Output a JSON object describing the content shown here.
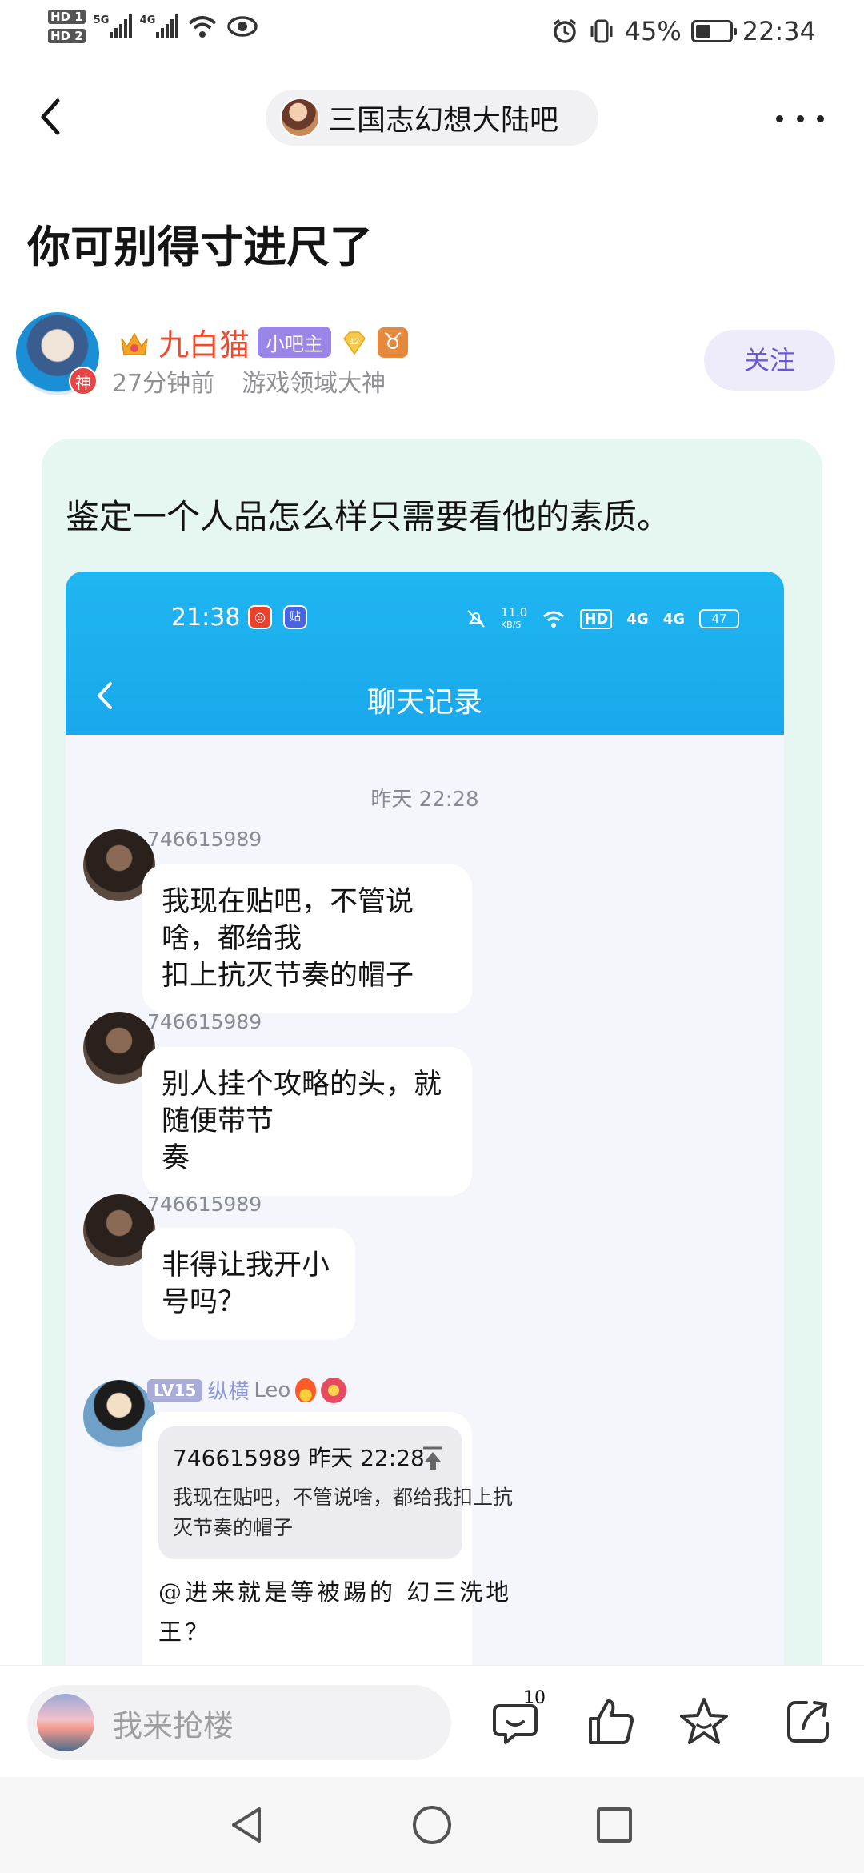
{
  "status_bar": {
    "hd1": "HD 1",
    "hd2": "HD 2",
    "net1": "5G",
    "net2": "4G",
    "battery": "45%",
    "time": "22:34"
  },
  "header": {
    "forum_name": "三国志幻想大陆吧"
  },
  "post": {
    "title": "你可别得寸进尺了",
    "author_name": "九白猫",
    "role": "小吧主",
    "level": "12",
    "zodiac": "♉",
    "god_badge": "神",
    "time_ago": "27分钟前",
    "author_title": "游戏领域大神",
    "follow_label": "关注",
    "text": "鉴定一个人品怎么样只需要看他的素质。"
  },
  "screenshot": {
    "time": "21:38",
    "net_speed_value": "11.0",
    "net_speed_unit": "KB/S",
    "hd": "HD",
    "sig1": "4G",
    "sig2": "4G",
    "battery": "47",
    "title": "聊天记录",
    "date": "昨天 22:28",
    "messages": [
      {
        "sender": "746615989",
        "text1": "我现在贴吧，不管说啥，都给我",
        "text2": "扣上抗灭节奏的帽子"
      },
      {
        "sender": "746615989",
        "text1": "别人挂个攻略的头，就随便带节",
        "text2": "奏"
      },
      {
        "sender": "746615989",
        "text1": "非得让我开小号吗？"
      }
    ],
    "reply": {
      "level": "LV15",
      "group": "纵横",
      "name": "Leo",
      "quote_head": "746615989 昨天 22:28",
      "quote_line1": "我现在贴吧，不管说啥，都给我扣上抗",
      "quote_line2": "灭节奏的帽子",
      "text1": "@进来就是等被踢的 幻三洗地",
      "text2": "王？"
    }
  },
  "bottom_bar": {
    "placeholder": "我来抢楼",
    "comment_count": "10"
  },
  "colors": {
    "accent": "#6b58d8",
    "author_name": "#f04a2c",
    "card_bg": "#e6f6f0",
    "chat_header": "#19a8ec"
  }
}
